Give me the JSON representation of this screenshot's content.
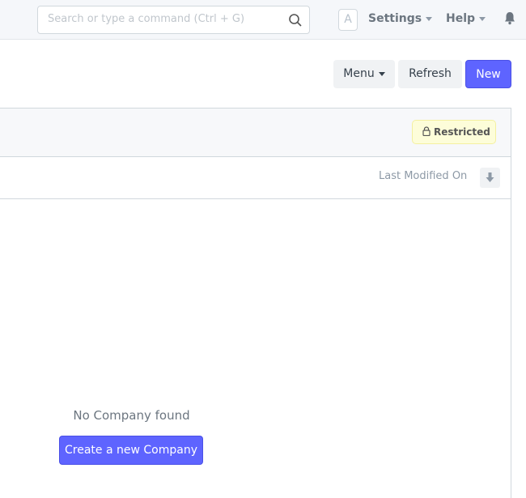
{
  "navbar": {
    "search_placeholder": "Search or type a command (Ctrl + G)",
    "avatar_letter": "A",
    "settings": "Settings",
    "help": "Help"
  },
  "page_actions": {
    "menu": "Menu",
    "refresh": "Refresh",
    "new": "New"
  },
  "filter": {
    "restricted": "Restricted"
  },
  "sort": {
    "label": "Last Modified On"
  },
  "empty": {
    "message": "No Company found",
    "create_button": "Create a new Company"
  },
  "colors": {
    "primary": "#5e64ff",
    "restricted_bg": "#fdfdd9"
  }
}
